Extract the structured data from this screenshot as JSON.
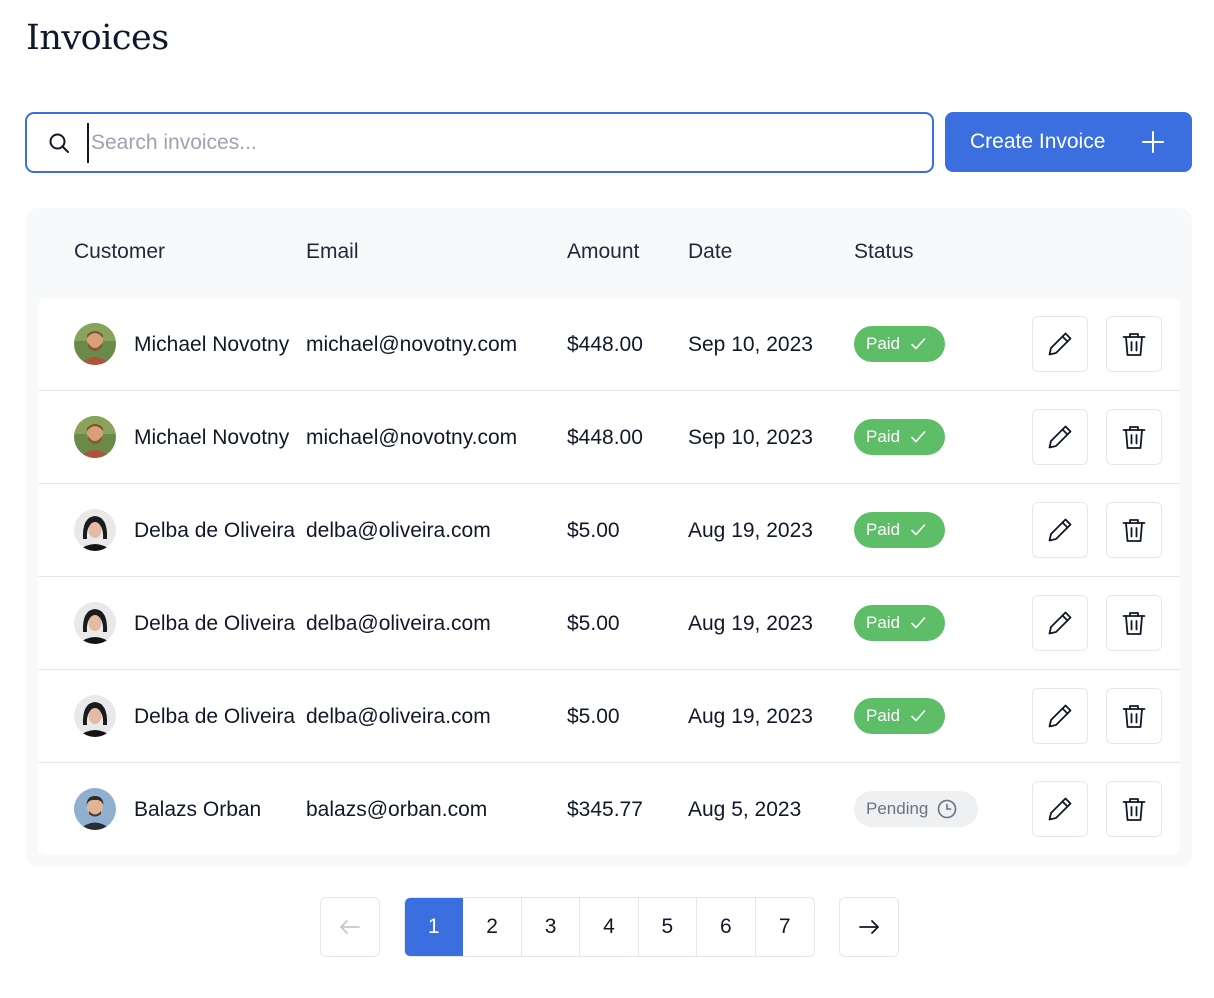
{
  "page": {
    "title": "Invoices"
  },
  "search": {
    "placeholder": "Search invoices...",
    "value": ""
  },
  "toolbar": {
    "create_label": "Create Invoice"
  },
  "table": {
    "headers": {
      "customer": "Customer",
      "email": "Email",
      "amount": "Amount",
      "date": "Date",
      "status": "Status"
    },
    "rows": [
      {
        "customer": "Michael Novotny",
        "email": "michael@novotny.com",
        "amount": "$448.00",
        "date": "Sep 10, 2023",
        "status": "Paid"
      },
      {
        "customer": "Michael Novotny",
        "email": "michael@novotny.com",
        "amount": "$448.00",
        "date": "Sep 10, 2023",
        "status": "Paid"
      },
      {
        "customer": "Delba de Oliveira",
        "email": "delba@oliveira.com",
        "amount": "$5.00",
        "date": "Aug 19, 2023",
        "status": "Paid"
      },
      {
        "customer": "Delba de Oliveira",
        "email": "delba@oliveira.com",
        "amount": "$5.00",
        "date": "Aug 19, 2023",
        "status": "Paid"
      },
      {
        "customer": "Delba de Oliveira",
        "email": "delba@oliveira.com",
        "amount": "$5.00",
        "date": "Aug 19, 2023",
        "status": "Paid"
      },
      {
        "customer": "Balazs Orban",
        "email": "balazs@orban.com",
        "amount": "$345.77",
        "date": "Aug 5, 2023",
        "status": "Pending"
      }
    ]
  },
  "pagination": {
    "pages": [
      "1",
      "2",
      "3",
      "4",
      "5",
      "6",
      "7"
    ],
    "current": "1"
  },
  "icons": {
    "search": "search-icon",
    "plus": "plus-icon",
    "edit": "pencil-icon",
    "delete": "trash-icon",
    "paid": "check-icon",
    "pending": "clock-icon",
    "prev": "arrow-left-icon",
    "next": "arrow-right-icon"
  },
  "colors": {
    "accent": "#3b6fe0",
    "paid": "#5ebd67",
    "pending_bg": "#eef0f2",
    "pending_text": "#6b7280"
  }
}
